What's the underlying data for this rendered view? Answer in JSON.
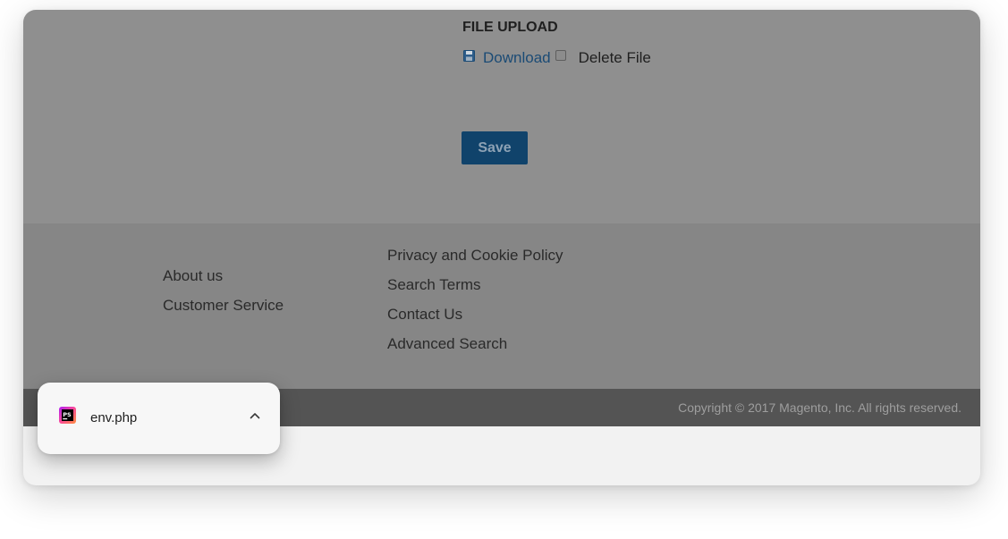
{
  "upload": {
    "title": "FILE UPLOAD",
    "download_label": "Download",
    "delete_label": "Delete File",
    "delete_checked": false
  },
  "form": {
    "save_label": "Save"
  },
  "footer": {
    "left_links": [
      "About us",
      "Customer Service"
    ],
    "right_links": [
      "Privacy and Cookie Policy",
      "Search Terms",
      "Contact Us",
      "Advanced Search"
    ],
    "copyright": "Copyright © 2017 Magento, Inc. All rights reserved."
  },
  "download_bar": {
    "file_name": "env.php",
    "file_icon": "phpstorm-file-icon",
    "expand_icon": "chevron-up-icon"
  },
  "colors": {
    "link": "#1b4b75",
    "save_button": "#10436b",
    "overlay_content": "#8f8f8f",
    "overlay_footer": "#868686",
    "copyright_bar": "#545454"
  }
}
